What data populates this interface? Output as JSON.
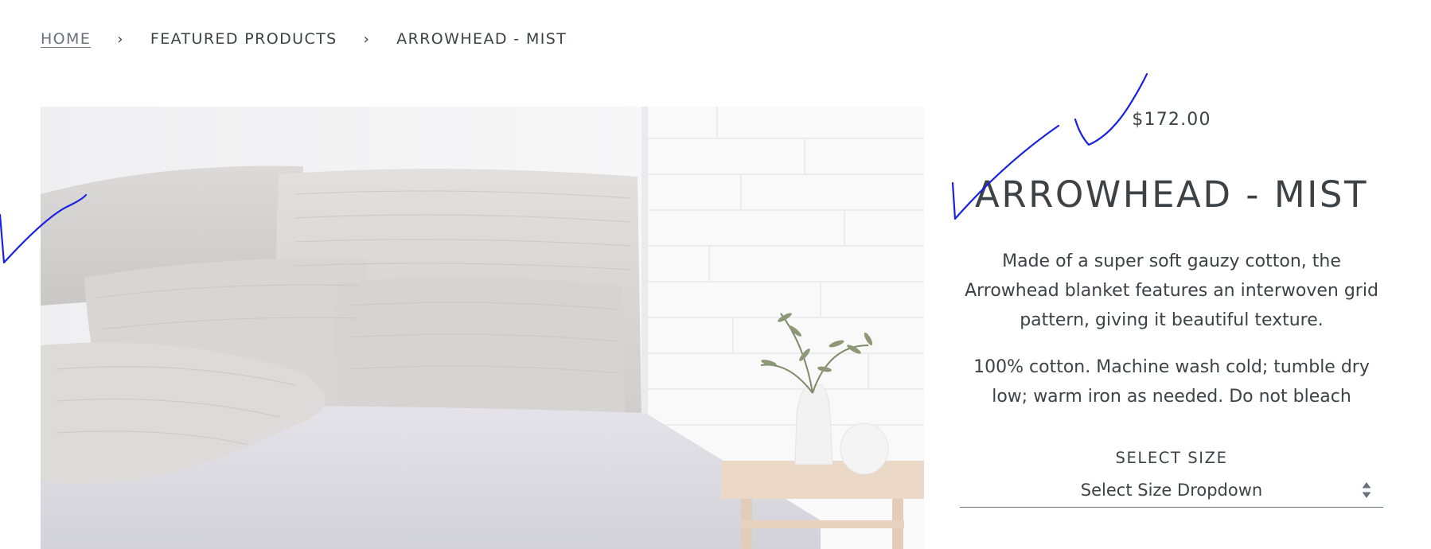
{
  "breadcrumb": {
    "home": "HOME",
    "separator": "›",
    "featured": "FEATURED PRODUCTS",
    "current": "ARROWHEAD - MIST"
  },
  "product": {
    "image_alt": "Arrowhead blanket in Mist with pillows on a bed",
    "price": "$172.00",
    "title": "ARROWHEAD - MIST",
    "description": "Made of a super soft gauzy cotton, the Arrowhead blanket features an interwoven grid pattern, giving it beautiful texture.",
    "care": "100% cotton. Machine wash cold; tumble dry low; warm iron as needed. Do not bleach"
  },
  "size_selector": {
    "label": "SELECT SIZE",
    "value": "Select Size Dropdown",
    "icon": "up-down-arrows-icon"
  },
  "colors": {
    "text": "#3d4246",
    "muted_link": "#69727b",
    "annotation_ink": "#1a22e0"
  }
}
